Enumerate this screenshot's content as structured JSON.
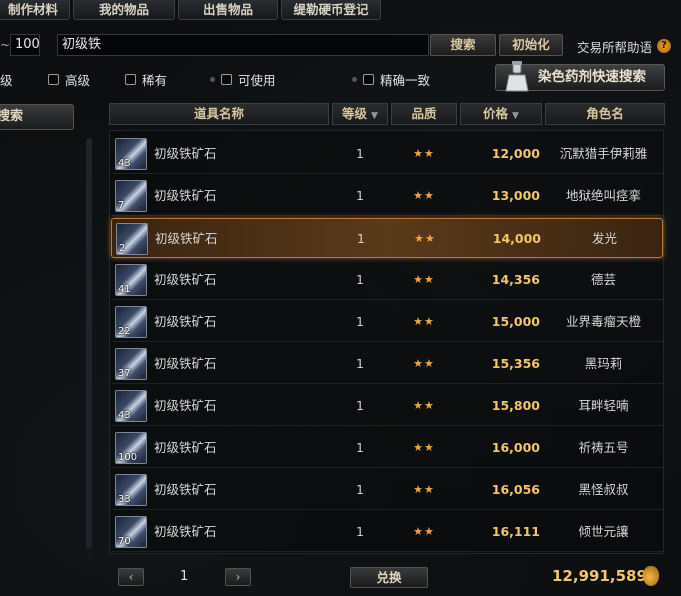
{
  "tabs": [
    "制作材料",
    "我的物品",
    "出售物品",
    "缇勒硬币登记"
  ],
  "search": {
    "level_value": "100",
    "query": "初级铁",
    "search_label": "搜索",
    "reset_label": "初始化",
    "help_label": "交易所帮助语",
    "help_icon": "?"
  },
  "filters": {
    "level_partial": "级",
    "advanced": "高级",
    "rare": "稀有",
    "usable": "可使用",
    "exact": "精确一致"
  },
  "dye_search_label": "染色药剂快速搜索",
  "left_search_label": "搜索",
  "columns": [
    "道具名称",
    "等级",
    "品质",
    "价格",
    "角色名"
  ],
  "rows": [
    {
      "name": "初级铁矿石",
      "qty": "43",
      "level": "1",
      "quality": "★★",
      "price": "12,000",
      "seller": "沉默猎手伊莉雅"
    },
    {
      "name": "初级铁矿石",
      "qty": "7",
      "level": "1",
      "quality": "★★",
      "price": "13,000",
      "seller": "地狱绝叫痉挛"
    },
    {
      "name": "初级铁矿石",
      "qty": "2",
      "level": "1",
      "quality": "★★",
      "price": "14,000",
      "seller": "发光"
    },
    {
      "name": "初级铁矿石",
      "qty": "41",
      "level": "1",
      "quality": "★★",
      "price": "14,356",
      "seller": "德芸"
    },
    {
      "name": "初级铁矿石",
      "qty": "22",
      "level": "1",
      "quality": "★★",
      "price": "15,000",
      "seller": "业界毒瘤天橙"
    },
    {
      "name": "初级铁矿石",
      "qty": "37",
      "level": "1",
      "quality": "★★",
      "price": "15,356",
      "seller": "黑玛莉"
    },
    {
      "name": "初级铁矿石",
      "qty": "43",
      "level": "1",
      "quality": "★★",
      "price": "15,800",
      "seller": "耳畔轻喃"
    },
    {
      "name": "初级铁矿石",
      "qty": "100",
      "level": "1",
      "quality": "★★",
      "price": "16,000",
      "seller": "祈祷五号"
    },
    {
      "name": "初级铁矿石",
      "qty": "33",
      "level": "1",
      "quality": "★★",
      "price": "16,056",
      "seller": "黑怪叔叔"
    },
    {
      "name": "初级铁矿石",
      "qty": "70",
      "level": "1",
      "quality": "★★",
      "price": "16,111",
      "seller": "倾世元讓"
    }
  ],
  "selected_row": 2,
  "footer": {
    "prev": "‹",
    "next": "›",
    "page": "1",
    "exchange_label": "兑换",
    "gold": "12,991,589"
  },
  "colors": {
    "accent": "#f4c46a",
    "selected_border": "#b87a35",
    "stars": "#f0a53a"
  }
}
